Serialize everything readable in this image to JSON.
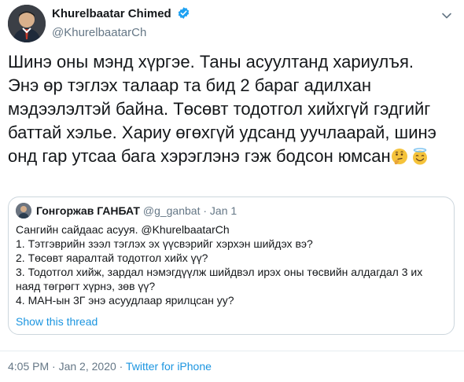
{
  "author": {
    "name": "Khurelbaatar Chimed",
    "handle": "@KhurelbaatarCh",
    "verified": true
  },
  "tweet": {
    "lines": [
      "Шинэ оны мэнд хүргэе. Таны асуултанд хариулъя.",
      "Энэ өр тэглэх талаар та бид 2 бараг адилхан",
      "мэдээлэлтэй байна. Төсөвт тодотгол хийхгүй гэдгийг",
      "баттай хэлье. Хариу өгөхгүй удсанд уучлаарай, шинэ",
      "онд гар утсаа бага хэрэглэнэ гэж бодсон юмсан"
    ],
    "emojis": [
      "thinking-face",
      "smiling-face-with-halo"
    ]
  },
  "quoted_tweet": {
    "name": "Гонгоржав ГАНБАТ",
    "handle": "@g_ganbat",
    "separator": "·",
    "date": "Jan 1",
    "lines": [
      "Сангийн сайдаас асууя. @KhurelbaatarCh",
      "1. Тэтгэврийн зээл тэглэх эх үүсвэрийг хэрхэн шийдэх вэ?",
      "2. Төсөвт яаралтай тодотгол хийх үү?",
      "3. Тодотгол хийж, зардал нэмэгдүүлж шийдвэл ирэх оны төсвийн алдагдал 3 их",
      "наяд төгрөгт хүрнэ, зөв үү?",
      "4. МАН-ын 3Г энэ асуудлаар ярилцсан уу?"
    ],
    "show_thread": "Show this thread"
  },
  "meta": {
    "time": "4:05 PM",
    "separator": "·",
    "date": "Jan 2, 2020",
    "source": "Twitter for iPhone"
  },
  "colors": {
    "link": "#1b95e0",
    "secondary_text": "#657786",
    "border": "#ccd6dd",
    "verified": "#1da1f2"
  },
  "icons": [
    "verified-badge-icon",
    "chevron-down-icon",
    "thinking-face-emoji",
    "halo-face-emoji"
  ]
}
